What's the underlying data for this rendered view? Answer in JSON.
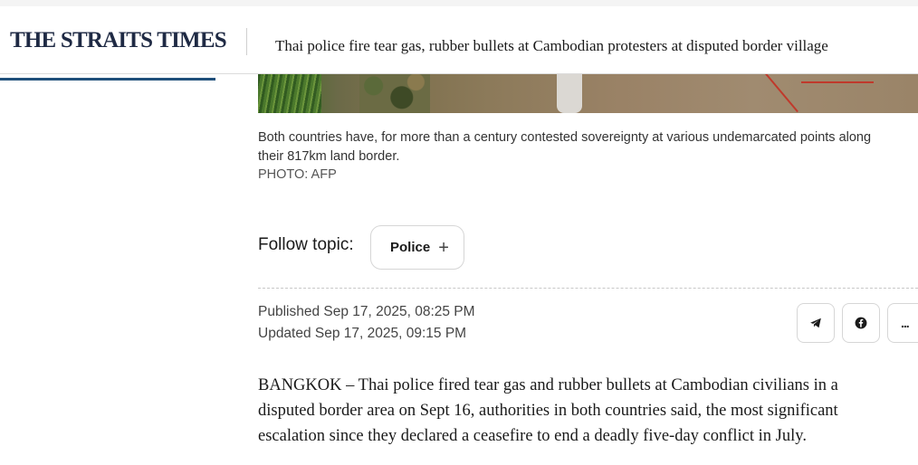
{
  "header": {
    "logo": "THE STRAITS TIMES",
    "headline": "Thai police fire tear gas, rubber bullets at Cambodian protesters at disputed border village"
  },
  "photo": {
    "caption_line1": "Both countries have, for more than a century contested sovereignty at various undemarcated points along",
    "caption_line2": "their 817km land border.",
    "credit": "PHOTO: AFP"
  },
  "follow": {
    "label": "Follow topic:",
    "topic": "Police",
    "topic_icon": "plus-icon"
  },
  "meta": {
    "published": "Published Sep 17, 2025, 08:25 PM",
    "updated": "Updated Sep 17, 2025, 09:15 PM"
  },
  "share": {
    "icons": [
      "telegram-icon",
      "facebook-icon",
      "more-icon"
    ],
    "more_label": "..."
  },
  "article": {
    "lines": [
      "BANGKOK – Thai police fired tear gas and rubber bullets at Cambodian civilians in a",
      "disputed border area on Sept 16, authorities in both countries said, the most significant",
      "escalation since they declared a ceasefire to end a deadly five-day conflict in July."
    ]
  },
  "colors": {
    "logo": "#1f2a44",
    "accent": "#1f4f7a"
  }
}
